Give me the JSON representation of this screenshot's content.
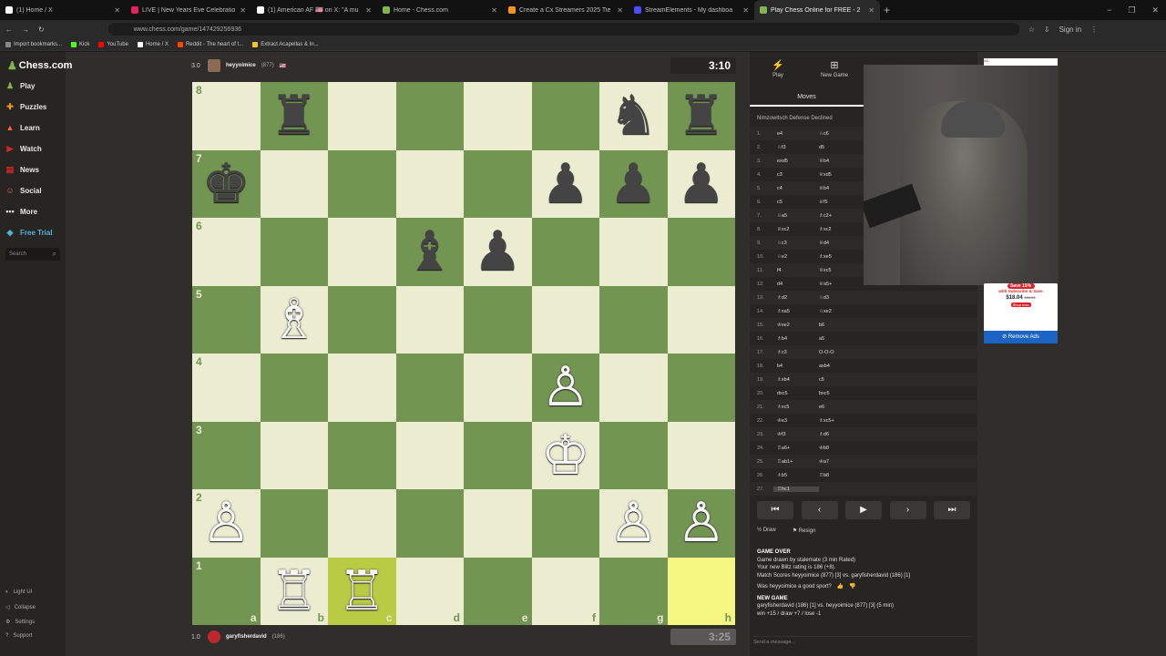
{
  "browser": {
    "tabs": [
      {
        "title": "(1) Home / X",
        "color": "#fff"
      },
      {
        "title": "LIVE | New Years Eve Celebratio",
        "color": "#e0245e"
      },
      {
        "title": "(1) American AF 🇺🇸 on X: \"A mu",
        "color": "#fff"
      },
      {
        "title": "Home - Chess.com",
        "color": "#81b64c"
      },
      {
        "title": "Create a Cx Streamers 2025 Tie",
        "color": "#f7931e"
      },
      {
        "title": "StreamElements - My dashboa",
        "color": "#4b4bff"
      },
      {
        "title": "Play Chess Online for FREE - 2 ",
        "color": "#81b64c"
      }
    ],
    "new_tab": "+",
    "url": "www.chess.com/game/147429256936",
    "window_controls": [
      "−",
      "❐",
      "✕"
    ],
    "bookmarks": [
      {
        "label": "Import bookmarks...",
        "color": "#888"
      },
      {
        "label": "Kick",
        "color": "#53fc18"
      },
      {
        "label": "YouTube",
        "color": "#f00"
      },
      {
        "label": "Home / X",
        "color": "#fff"
      },
      {
        "label": "Reddit - The heart of t...",
        "color": "#ff4500"
      },
      {
        "label": "Extract Acapellas & In...",
        "color": "#f5c518"
      }
    ],
    "profile": "Sign in"
  },
  "sidebar": {
    "logo": "Chess.com",
    "items": [
      {
        "label": "Play",
        "icon": "♟",
        "color": "#81b64c"
      },
      {
        "label": "Puzzles",
        "icon": "✚",
        "color": "#f7931e"
      },
      {
        "label": "Learn",
        "icon": "▲",
        "color": "#ff6633"
      },
      {
        "label": "Watch",
        "icon": "▶",
        "color": "#d9232a"
      },
      {
        "label": "News",
        "icon": "▤",
        "color": "#d9232a"
      },
      {
        "label": "Social",
        "icon": "☺",
        "color": "#e06666"
      },
      {
        "label": "More",
        "icon": "•••",
        "color": "#ddd"
      },
      {
        "label": "Free Trial",
        "icon": "◆",
        "color": "#4fb3d9"
      }
    ],
    "search_placeholder": "Search",
    "bottom": [
      {
        "label": "Light UI",
        "icon": "◐"
      },
      {
        "label": "Collapse",
        "icon": "◁"
      },
      {
        "label": "Settings",
        "icon": "⚙"
      },
      {
        "label": "Support",
        "icon": "?"
      }
    ]
  },
  "top_player": {
    "score": "3.0",
    "name": "heyyoimice",
    "rating": "(877)",
    "flag": "🇺🇸",
    "clock": "3:10"
  },
  "bottom_player": {
    "score": "1.0",
    "name": "garyfisherdavid",
    "rating": "(186)",
    "clock": "3:25"
  },
  "board": {
    "ranks": [
      "8",
      "7",
      "6",
      "5",
      "4",
      "3",
      "2",
      "1"
    ],
    "files": [
      "a",
      "b",
      "c",
      "d",
      "e",
      "f",
      "g",
      "h"
    ],
    "pieces": [
      {
        "sq": "b8",
        "p": "♜",
        "c": "b"
      },
      {
        "sq": "g8",
        "p": "♞",
        "c": "b"
      },
      {
        "sq": "h8",
        "p": "♜",
        "c": "b"
      },
      {
        "sq": "a7",
        "p": "♚",
        "c": "b"
      },
      {
        "sq": "f7",
        "p": "♟",
        "c": "b"
      },
      {
        "sq": "g7",
        "p": "♟",
        "c": "b"
      },
      {
        "sq": "h7",
        "p": "♟",
        "c": "b"
      },
      {
        "sq": "d6",
        "p": "♝",
        "c": "b"
      },
      {
        "sq": "e6",
        "p": "♟",
        "c": "b"
      },
      {
        "sq": "b5",
        "p": "♗",
        "c": "w"
      },
      {
        "sq": "f4",
        "p": "♙",
        "c": "w"
      },
      {
        "sq": "f3",
        "p": "♔",
        "c": "w"
      },
      {
        "sq": "a2",
        "p": "♙",
        "c": "w"
      },
      {
        "sq": "g2",
        "p": "♙",
        "c": "w"
      },
      {
        "sq": "h2",
        "p": "♙",
        "c": "w"
      },
      {
        "sq": "b1",
        "p": "♖",
        "c": "w"
      },
      {
        "sq": "c1",
        "p": "♖",
        "c": "w"
      }
    ],
    "highlights": [
      "c1",
      "h1"
    ]
  },
  "panel": {
    "tabs": [
      {
        "label": "Play",
        "icon": "⚡"
      },
      {
        "label": "New Game",
        "icon": "⊞"
      },
      {
        "label": "",
        "icon": ""
      },
      {
        "label": "",
        "icon": ""
      }
    ],
    "moves_tab": "Moves",
    "opening": "Nimzowitsch Defense Declined",
    "moves": [
      [
        "1.",
        "e4",
        "♘c6"
      ],
      [
        "2.",
        "♘f3",
        "d5"
      ],
      [
        "3.",
        "exd5",
        "♕b4"
      ],
      [
        "4.",
        "c3",
        "♕xd5"
      ],
      [
        "5.",
        "c4",
        "♕b4"
      ],
      [
        "6.",
        "c5",
        "♕f5"
      ],
      [
        "7.",
        "♘a5",
        "♗c2+"
      ],
      [
        "8.",
        "♕xc2",
        "♗xc2"
      ],
      [
        "9.",
        "♘c3",
        "♕d4"
      ],
      [
        "10.",
        "♘e2",
        "♗xe5"
      ],
      [
        "11.",
        "f4",
        "♕xc5"
      ],
      [
        "12.",
        "d4",
        "♕a5+"
      ],
      [
        "13.",
        "♗d2",
        "♘d3"
      ],
      [
        "14.",
        "♗xa5",
        "♘xe2"
      ],
      [
        "15.",
        "♔xe2",
        "b6"
      ],
      [
        "16.",
        "♗b4",
        "a5"
      ],
      [
        "17.",
        "♗c3",
        "O-O-O"
      ],
      [
        "18.",
        "b4",
        "axb4"
      ],
      [
        "19.",
        "♗xb4",
        "c5"
      ],
      [
        "20.",
        "dxc5",
        "bxc5"
      ],
      [
        "21.",
        "♗xc5",
        "e6"
      ],
      [
        "22.",
        "♔e3",
        "♗xc5+"
      ],
      [
        "23.",
        "♔f3",
        "♗d6"
      ],
      [
        "24.",
        "♖a6+",
        "♔b8"
      ],
      [
        "25.",
        "♖ab1+",
        "♔a7"
      ],
      [
        "26.",
        "♗b5",
        "♖b8"
      ],
      [
        "27.",
        "♖hc1",
        ""
      ]
    ],
    "nav_buttons": [
      "⏮",
      "‹",
      "▶",
      "›",
      "⏭"
    ],
    "actions": [
      {
        "label": "Draw",
        "icon": "½"
      },
      {
        "label": "Resign",
        "icon": "⚑"
      }
    ],
    "game_over": {
      "title": "GAME OVER",
      "line1": "Game drawn by stalemate (3 min Rated)",
      "line2": "Your new Blitz rating is 186 (+8).",
      "line3": "Match Scores heyyoimice (877) [3] vs. garyfisherdavid (186) [1]",
      "question": "Was heyyoimice a good sport?",
      "new_game_title": "NEW GAME",
      "new_game_line": "garyfisherdavid (186) [1] vs. heyyoimice (877) [3] (5 min)",
      "record": "win +15 / draw +7 / lose -1"
    },
    "chat_placeholder": "Send a message..."
  },
  "ad": {
    "top": "AD",
    "save": "Save 15%",
    "subscribe": "with Subscribe & Save",
    "price": "$18.04",
    "old_price": "$18.99",
    "shop": "Shop now",
    "remove": "Remove Ads"
  }
}
